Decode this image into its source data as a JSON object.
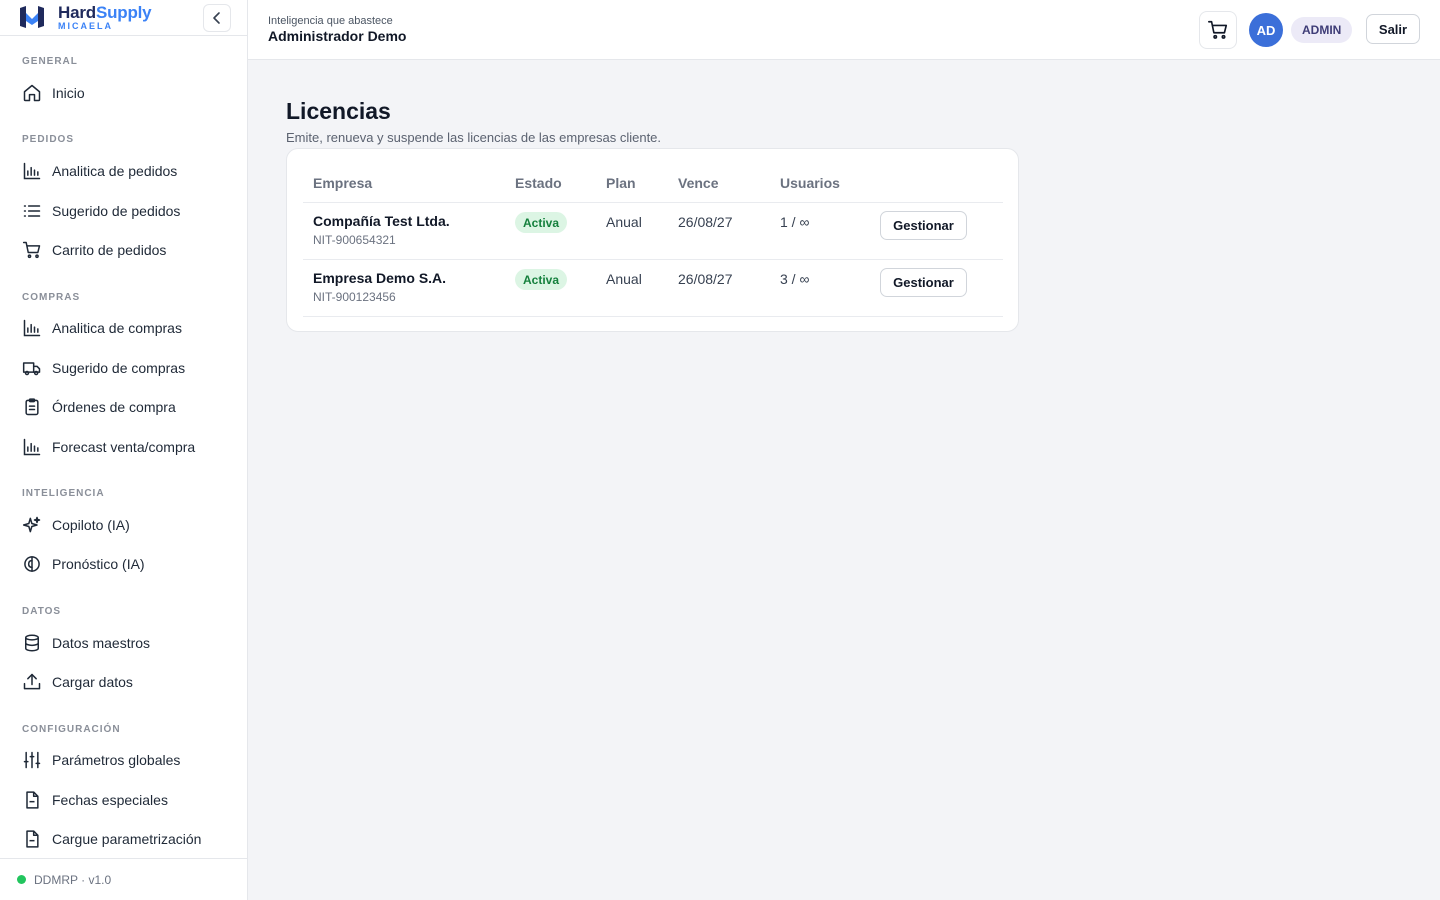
{
  "brand": {
    "name_part1": "Hard",
    "name_part2": "Supply",
    "subtitle": "MICAELA"
  },
  "sidebar": {
    "sections": [
      {
        "label": "GENERAL",
        "items": [
          {
            "label": "Inicio",
            "icon": "home-icon"
          }
        ]
      },
      {
        "label": "PEDIDOS",
        "items": [
          {
            "label": "Analitica de pedidos",
            "icon": "bar-chart-icon"
          },
          {
            "label": "Sugerido de pedidos",
            "icon": "list-icon"
          },
          {
            "label": "Carrito de pedidos",
            "icon": "cart-icon"
          }
        ]
      },
      {
        "label": "COMPRAS",
        "items": [
          {
            "label": "Analitica de compras",
            "icon": "bar-chart-icon"
          },
          {
            "label": "Sugerido de compras",
            "icon": "truck-icon"
          },
          {
            "label": "Órdenes de compra",
            "icon": "clipboard-icon"
          },
          {
            "label": "Forecast venta/compra",
            "icon": "bar-chart-icon"
          }
        ]
      },
      {
        "label": "INTELIGENCIA",
        "items": [
          {
            "label": "Copiloto (IA)",
            "icon": "sparkles-icon"
          },
          {
            "label": "Pronóstico (IA)",
            "icon": "brain-icon"
          }
        ]
      },
      {
        "label": "DATOS",
        "items": [
          {
            "label": "Datos maestros",
            "icon": "database-icon"
          },
          {
            "label": "Cargar datos",
            "icon": "upload-icon"
          }
        ]
      },
      {
        "label": "CONFIGURACIÓN",
        "items": [
          {
            "label": "Parámetros globales",
            "icon": "sliders-icon"
          },
          {
            "label": "Fechas especiales",
            "icon": "file-icon"
          },
          {
            "label": "Cargue parametrización",
            "icon": "file-icon"
          }
        ]
      }
    ],
    "footer": {
      "version": "DDMRP · v1.0",
      "status_color": "#22c55e"
    }
  },
  "topbar": {
    "tagline": "Inteligencia que abastece",
    "user_name": "Administrador Demo",
    "avatar_initials": "AD",
    "role": "ADMIN",
    "logout_label": "Salir"
  },
  "main": {
    "title": "Licencias",
    "subtitle": "Emite, renueva y suspende las licencias de las empresas cliente.",
    "table": {
      "headers": [
        "Empresa",
        "Estado",
        "Plan",
        "Vence",
        "Usuarios"
      ],
      "rows": [
        {
          "company": "Compañía Test Ltda.",
          "nit": "NIT-900654321",
          "status": "Activa",
          "plan": "Anual",
          "expires": "26/08/27",
          "users": "1 / ∞",
          "action": "Gestionar"
        },
        {
          "company": "Empresa Demo S.A.",
          "nit": "NIT-900123456",
          "status": "Activa",
          "plan": "Anual",
          "expires": "26/08/27",
          "users": "3 / ∞",
          "action": "Gestionar"
        }
      ]
    }
  },
  "colors": {
    "accent": "#3b82f6",
    "brand_dark": "#1f2a5c",
    "status_active_bg": "#dcf5e4",
    "status_active_fg": "#15803d"
  }
}
